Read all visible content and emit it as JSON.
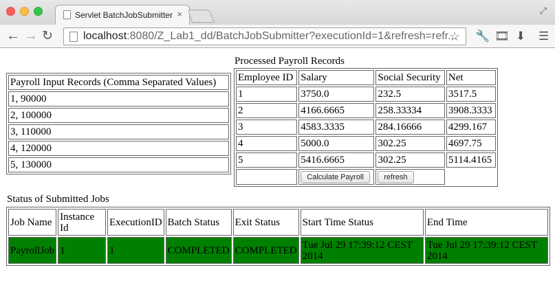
{
  "browser": {
    "tab_title": "Servlet BatchJobSubmitter",
    "tab_close": "×",
    "url_host": "localhost",
    "url_rest": ":8080/Z_Lab1_dd/BatchJobSubmitter?executionId=1&refresh=refr...",
    "icons": [
      "back-icon",
      "forward-icon",
      "reload-icon",
      "star-icon",
      "wrench-icon",
      "film-icon",
      "download-icon",
      "menu-icon",
      "fullscreen-icon"
    ]
  },
  "input": {
    "header": "Payroll Input Records (Comma Separated Values)",
    "records": [
      "1, 90000",
      "2, 100000",
      "3, 110000",
      "4, 120000",
      "5, 130000"
    ]
  },
  "payroll": {
    "caption": "Processed Payroll Records",
    "headers": [
      "Employee ID",
      "Salary",
      "Social Security",
      "Net"
    ],
    "rows": [
      [
        "1",
        "3750.0",
        "232.5",
        "3517.5"
      ],
      [
        "2",
        "4166.6665",
        "258.33334",
        "3908.3333"
      ],
      [
        "3",
        "4583.3335",
        "284.16666",
        "4299.167"
      ],
      [
        "4",
        "5000.0",
        "302.25",
        "4697.75"
      ],
      [
        "5",
        "5416.6665",
        "302.25",
        "5114.4165"
      ]
    ],
    "calculate_label": "Calculate Payroll",
    "refresh_label": "refresh"
  },
  "jobs": {
    "caption": "Status of Submitted Jobs",
    "headers": [
      "Job Name",
      "Instance Id",
      "ExecutionID",
      "Batch Status",
      "Exit Status",
      "Start Time Status",
      "End Time"
    ],
    "rows": [
      [
        "PayrollJob",
        "1",
        "1",
        "COMPLETED",
        "COMPLETED",
        "Tue Jul 29 17:39:12 CEST 2014",
        "Tue Jul 29 17:39:12 CEST 2014"
      ]
    ],
    "completed_color": "#008000"
  }
}
